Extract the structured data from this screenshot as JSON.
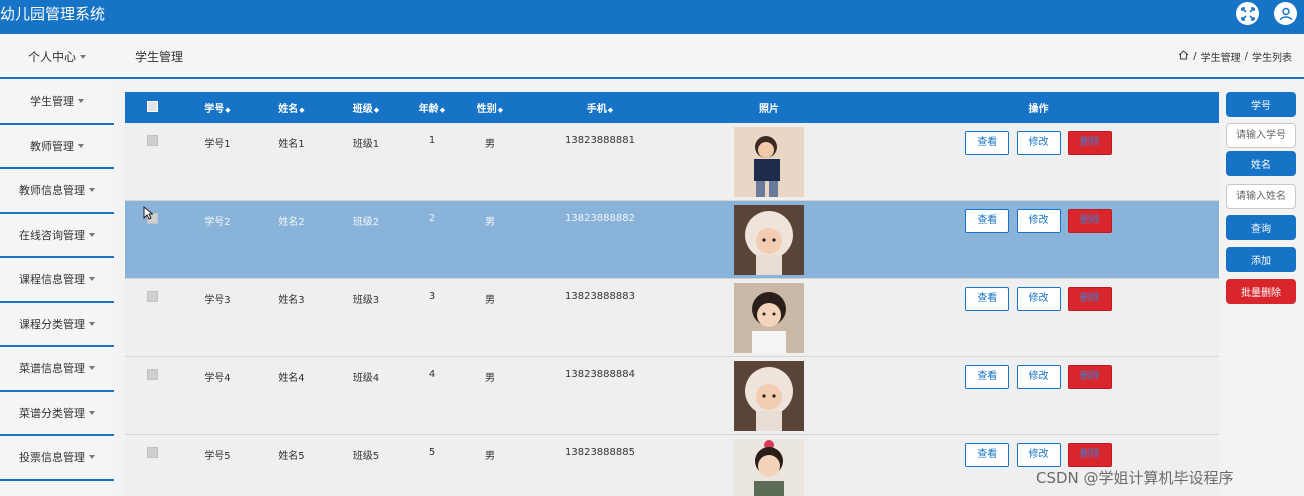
{
  "app": {
    "title": "幼儿园管理系统"
  },
  "header": {
    "personal_center": "个人中心",
    "section_title": "学生管理"
  },
  "breadcrumb": {
    "sep": "/",
    "items": [
      "学生管理",
      "学生列表"
    ]
  },
  "sidebar": {
    "items": [
      {
        "label": "学生管理"
      },
      {
        "label": "教师管理"
      },
      {
        "label": "教师信息管理"
      },
      {
        "label": "在线咨询管理"
      },
      {
        "label": "课程信息管理"
      },
      {
        "label": "课程分类管理"
      },
      {
        "label": "菜谱信息管理"
      },
      {
        "label": "菜谱分类管理"
      },
      {
        "label": "投票信息管理"
      }
    ]
  },
  "table": {
    "columns": [
      "学号",
      "姓名",
      "班级",
      "年龄",
      "性别",
      "手机",
      "照片",
      "操作"
    ],
    "rows": [
      {
        "id": "学号1",
        "name": "姓名1",
        "cls": "班级1",
        "age": "1",
        "gender": "男",
        "phone": "13823888881"
      },
      {
        "id": "学号2",
        "name": "姓名2",
        "cls": "班级2",
        "age": "2",
        "gender": "男",
        "phone": "13823888882"
      },
      {
        "id": "学号3",
        "name": "姓名3",
        "cls": "班级3",
        "age": "3",
        "gender": "男",
        "phone": "13823888883"
      },
      {
        "id": "学号4",
        "name": "姓名4",
        "cls": "班级4",
        "age": "4",
        "gender": "男",
        "phone": "13823888884"
      },
      {
        "id": "学号5",
        "name": "姓名5",
        "cls": "班级5",
        "age": "5",
        "gender": "男",
        "phone": "13823888885"
      }
    ],
    "actions": {
      "view": "查看",
      "edit": "修改",
      "delete": "删除"
    }
  },
  "search": {
    "id_label": "学号",
    "id_placeholder": "请输入学号",
    "name_label": "姓名",
    "name_placeholder": "请输入姓名",
    "query_btn": "查询",
    "add_btn": "添加",
    "batch_delete_btn": "批量删除"
  },
  "watermark": "CSDN @学姐计算机毕设程序",
  "colors": {
    "primary": "#1673c6",
    "danger": "#d8262c",
    "selected_row": "#89b3d8"
  }
}
